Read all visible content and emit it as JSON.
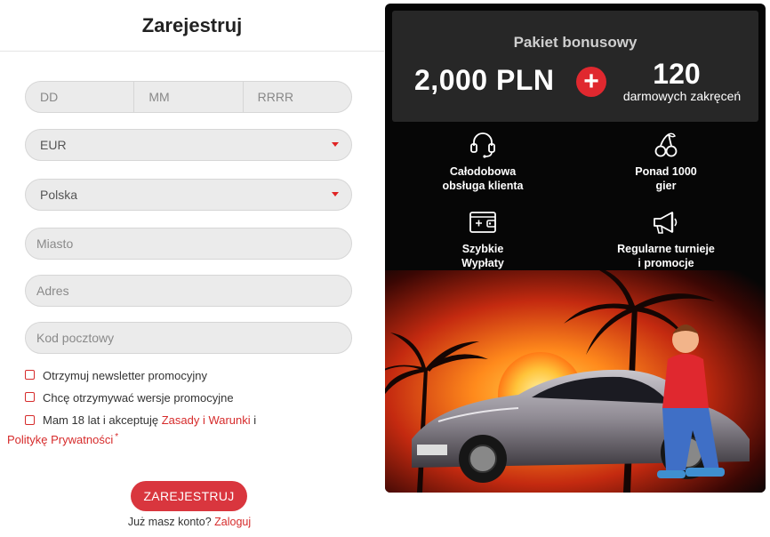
{
  "form": {
    "title": "Zarejestruj",
    "dob": {
      "day": "DD",
      "month": "MM",
      "year": "RRRR"
    },
    "currency": "EUR",
    "country": "Polska",
    "city_placeholder": "Miasto",
    "address_placeholder": "Adres",
    "postal_placeholder": "Kod pocztowy",
    "checks": {
      "newsletter": "Otrzymuj newsletter promocyjny",
      "promo_versions": "Chcę otrzymywać wersje promocyjne",
      "terms_prefix": "Mam 18 lat i akceptuję",
      "terms_link": "Zasady i Warunki",
      "terms_and": "i",
      "privacy_link": "Politykę Prywatności",
      "asterisk": "*"
    },
    "submit_label": "ZAREJESTRUJ",
    "login_prompt": "Już masz konto?",
    "login_link": "Zaloguj"
  },
  "promo": {
    "bonus_title": "Pakiet bonusowy",
    "bonus_amount": "2,000 PLN",
    "plus_sign": "+",
    "spins_count": "120",
    "spins_label": "darmowych zakręceń",
    "features": [
      {
        "icon": "headset-icon",
        "line1": "Całodobowa",
        "line2": "obsługa klienta"
      },
      {
        "icon": "cherries-icon",
        "line1": "Ponad 1000",
        "line2": "gier"
      },
      {
        "icon": "wallet-icon",
        "line1": "Szybkie",
        "line2": "Wypłaty"
      },
      {
        "icon": "megaphone-icon",
        "line1": "Regularne turnieje",
        "line2": "i promocje"
      }
    ]
  },
  "colors": {
    "accent": "#d9363e",
    "promo_bg": "#060606",
    "bonus_box": "#272727",
    "field_bg": "#ebebeb"
  }
}
